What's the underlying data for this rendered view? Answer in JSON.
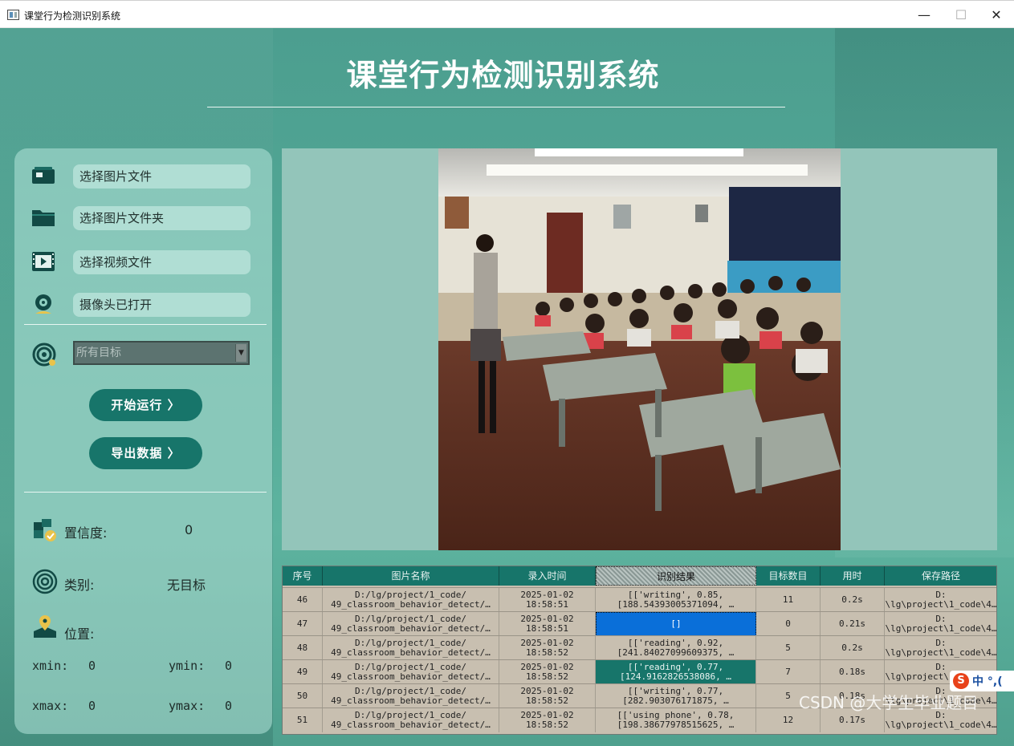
{
  "window": {
    "title": "课堂行为检测识别系统",
    "minimize": "—",
    "maximize": "☐",
    "close": "✕"
  },
  "header": {
    "title": "课堂行为检测识别系统"
  },
  "sidebar": {
    "menu": [
      {
        "label": "选择图片文件",
        "icon": "image-file-icon"
      },
      {
        "label": "选择图片文件夹",
        "icon": "folder-icon"
      },
      {
        "label": "选择视频文件",
        "icon": "video-file-icon"
      },
      {
        "label": "摄像头已打开",
        "icon": "webcam-icon"
      }
    ],
    "target_select": {
      "value": "所有目标",
      "arrow": "▼"
    },
    "run_button": "开始运行 〉",
    "export_button": "导出数据 〉",
    "confidence": {
      "label": "置信度:",
      "value": "0"
    },
    "category": {
      "label": "类别:",
      "value": "无目标"
    },
    "position": {
      "label": "位置:"
    },
    "coords": {
      "xmin_label": "xmin:",
      "xmin": "0",
      "ymin_label": "ymin:",
      "ymin": "0",
      "xmax_label": "xmax:",
      "xmax": "0",
      "ymax_label": "ymax:",
      "ymax": "0"
    }
  },
  "table": {
    "headers": [
      "序号",
      "图片名称",
      "录入时间",
      "识别结果",
      "目标数目",
      "用时",
      "保存路径"
    ],
    "rows": [
      {
        "id": "46",
        "name": "D:/lg/project/1_code/\n49_classroom_behavior_detect/…",
        "time": "2025-01-02\n18:58:51",
        "result": "[['writing', 0.85,\n[188.54393005371094, …",
        "count": "11",
        "elapsed": "0.2s",
        "path": "D:\n\\lg\\project\\1_code\\4…"
      },
      {
        "id": "47",
        "name": "D:/lg/project/1_code/\n49_classroom_behavior_detect/…",
        "time": "2025-01-02\n18:58:51",
        "result": "[]",
        "count": "0",
        "elapsed": "0.21s",
        "path": "D:\n\\lg\\project\\1_code\\4…"
      },
      {
        "id": "48",
        "name": "D:/lg/project/1_code/\n49_classroom_behavior_detect/…",
        "time": "2025-01-02\n18:58:52",
        "result": "[['reading', 0.92,\n[241.84027099609375, …",
        "count": "5",
        "elapsed": "0.2s",
        "path": "D:\n\\lg\\project\\1_code\\4…"
      },
      {
        "id": "49",
        "name": "D:/lg/project/1_code/\n49_classroom_behavior_detect/…",
        "time": "2025-01-02\n18:58:52",
        "result": "[['reading', 0.77,\n[124.9162826538086, …",
        "count": "7",
        "elapsed": "0.18s",
        "path": "D:\n\\lg\\project\\1_code\\4…"
      },
      {
        "id": "50",
        "name": "D:/lg/project/1_code/\n49_classroom_behavior_detect/…",
        "time": "2025-01-02\n18:58:52",
        "result": "[['writing', 0.77,\n[282.903076171875, …",
        "count": "5",
        "elapsed": "0.18s",
        "path": "D:\n\\lg\\project\\1_code\\4…"
      },
      {
        "id": "51",
        "name": "D:/lg/project/1_code/\n49_classroom_behavior_detect/…",
        "time": "2025-01-02\n18:58:52",
        "result": "[['using phone', 0.78,\n[198.38677978515625, …",
        "count": "12",
        "elapsed": "0.17s",
        "path": "D:\n\\lg\\project\\1_code\\4…"
      }
    ]
  },
  "overlay": {
    "watermark": "CSDN @大学生毕业题目",
    "ime_logo": "S",
    "ime_text": "中 °,("
  },
  "colors": {
    "accent": "#17756a",
    "background": "#52a896",
    "selected_blue": "#0a6fd9"
  }
}
